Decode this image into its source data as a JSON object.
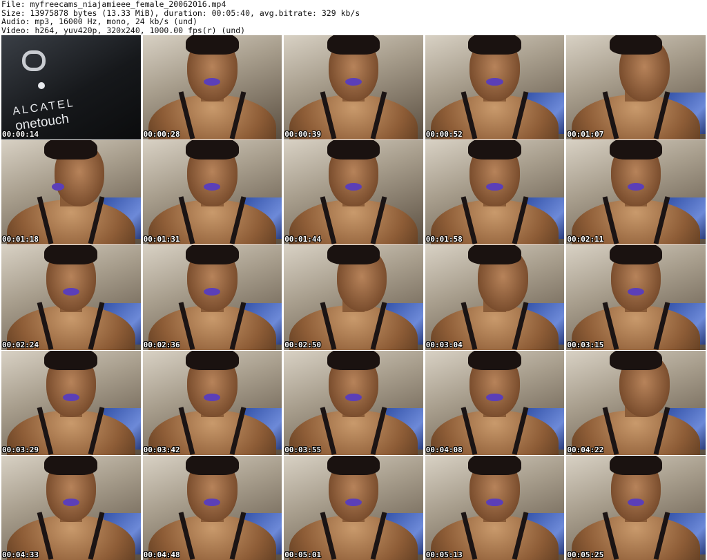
{
  "header": {
    "file_line": "File: myfreecams_niajamieee_female_20062016.mp4",
    "size_line": "Size: 13975878 bytes (13.33 MiB), duration: 00:05:40, avg.bitrate: 329 kb/s",
    "audio_line": "Audio: mp3, 16000 Hz, mono, 24 kb/s (und)",
    "video_line": "Video: h264, yuv420p, 320x240, 1000.00 fps(r) (und)"
  },
  "thumbnails": [
    {
      "timestamp": "00:00:14",
      "logo_brand": "ALCATEL",
      "logo_sub": "onetouch"
    },
    {
      "timestamp": "00:00:28"
    },
    {
      "timestamp": "00:00:39"
    },
    {
      "timestamp": "00:00:52"
    },
    {
      "timestamp": "00:01:07"
    },
    {
      "timestamp": "00:01:18"
    },
    {
      "timestamp": "00:01:31"
    },
    {
      "timestamp": "00:01:44"
    },
    {
      "timestamp": "00:01:58"
    },
    {
      "timestamp": "00:02:11"
    },
    {
      "timestamp": "00:02:24"
    },
    {
      "timestamp": "00:02:36"
    },
    {
      "timestamp": "00:02:50"
    },
    {
      "timestamp": "00:03:04"
    },
    {
      "timestamp": "00:03:15"
    },
    {
      "timestamp": "00:03:29"
    },
    {
      "timestamp": "00:03:42"
    },
    {
      "timestamp": "00:03:55"
    },
    {
      "timestamp": "00:04:08"
    },
    {
      "timestamp": "00:04:22"
    },
    {
      "timestamp": "00:04:33"
    },
    {
      "timestamp": "00:04:48"
    },
    {
      "timestamp": "00:05:01"
    },
    {
      "timestamp": "00:05:13"
    },
    {
      "timestamp": "00:05:25"
    }
  ]
}
